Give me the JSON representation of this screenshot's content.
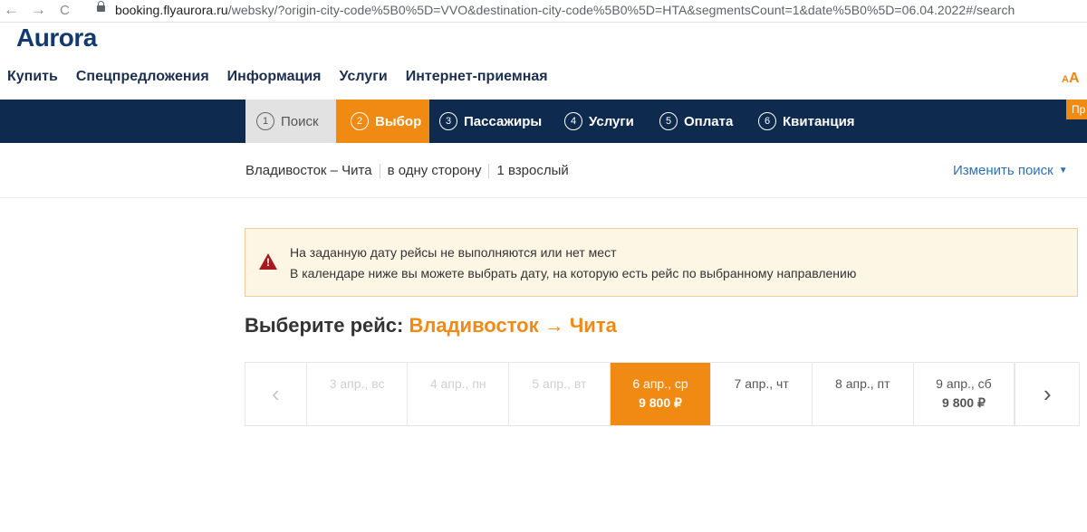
{
  "browser": {
    "back": "←",
    "forward": "→",
    "reload": "C",
    "url_host": "booking.flyaurora.ru",
    "url_rest": "/websky/?origin-city-code%5B0%5D=VVO&destination-city-code%5B0%5D=HTA&segmentsCount=1&date%5B0%5D=06.04.2022#/search"
  },
  "logo": "Aurora",
  "menu": [
    "Купить",
    "Спецпредложения",
    "Информация",
    "Услуги",
    "Интернет-приемная"
  ],
  "font_size_toggle": {
    "small": "A",
    "big": "A"
  },
  "steps": [
    {
      "num": "1",
      "label": "Поиск",
      "state": "done"
    },
    {
      "num": "2",
      "label": "Выбор",
      "state": "active"
    },
    {
      "num": "3",
      "label": "Пассажиры",
      "state": "pending"
    },
    {
      "num": "4",
      "label": "Услуги",
      "state": "pending"
    },
    {
      "num": "5",
      "label": "Оплата",
      "state": "pending"
    },
    {
      "num": "6",
      "label": "Квитанция",
      "state": "pending"
    }
  ],
  "promo_tab": "Пр",
  "summary": {
    "route": "Владивосток – Чита",
    "trip_type": "в одну сторону",
    "passengers": "1 взрослый",
    "change_search": "Изменить поиск"
  },
  "warning": {
    "line1": "На заданную дату рейсы не выполняются или нет мест",
    "line2": "В календаре ниже вы можете выбрать дату, на которую есть рейс по выбранному направлению"
  },
  "heading": {
    "prefix": "Выберите рейс:",
    "route": "Владивосток → Чита"
  },
  "calendar": {
    "days": [
      {
        "date": "3 апр., вс",
        "price": "",
        "state": "disabled"
      },
      {
        "date": "4 апр., пн",
        "price": "",
        "state": "disabled"
      },
      {
        "date": "5 апр., вт",
        "price": "",
        "state": "disabled"
      },
      {
        "date": "6 апр., ср",
        "price": "9 800 ₽",
        "state": "selected"
      },
      {
        "date": "7 апр., чт",
        "price": "",
        "state": "normal"
      },
      {
        "date": "8 апр., пт",
        "price": "",
        "state": "normal"
      },
      {
        "date": "9 апр., сб",
        "price": "9 800 ₽",
        "state": "normal"
      }
    ]
  },
  "colors": {
    "accent": "#f08a12",
    "nav_dark": "#0e2a4f",
    "link": "#2f6fb6",
    "warning_icon": "#a8181e"
  }
}
